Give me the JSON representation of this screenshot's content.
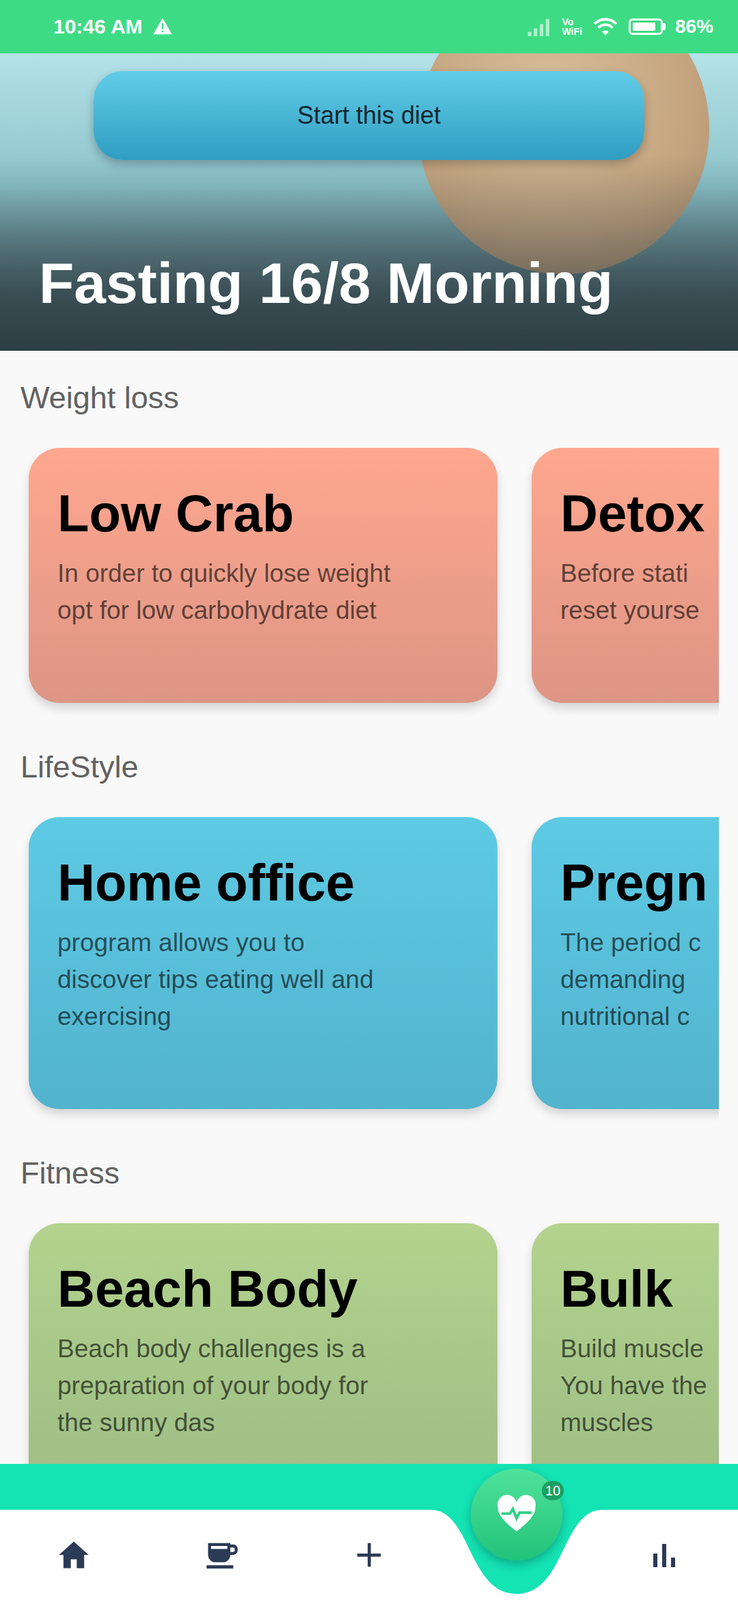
{
  "status_bar": {
    "time": "10:46 AM",
    "network_label_top": "Vo",
    "network_label_bottom": "WiFi",
    "battery": {
      "level": 0.86,
      "reading": "86%"
    }
  },
  "hero": {
    "title": "Fasting 16/8 Morning",
    "button": "Start this diet"
  },
  "sections": [
    {
      "title": "Weight loss",
      "color": "#ffa78f",
      "cards": [
        {
          "title": "Low Crab",
          "lines": [
            "In order to quickly lose weight",
            "opt for low carbohydrate diet"
          ]
        },
        {
          "title": "Detox",
          "lines": [
            "Before stati",
            "reset yourse"
          ]
        }
      ]
    },
    {
      "title": "LifeStyle",
      "color": "#5ecae4",
      "cards": [
        {
          "title": "Home office",
          "lines": [
            "program allows you to",
            "discover tips eating well and",
            "exercising"
          ]
        },
        {
          "title": "Pregn",
          "lines": [
            "The period c",
            "demanding",
            "nutritional c"
          ]
        }
      ]
    },
    {
      "title": "Fitness",
      "color": "#b3d38e",
      "cards": [
        {
          "title": "Beach Body",
          "lines": [
            "Beach body challenges is a",
            "preparation of your body for",
            "the sunny das"
          ]
        },
        {
          "title": "Bulk",
          "lines": [
            "Build muscle",
            "You have the",
            "muscles"
          ]
        }
      ]
    }
  ],
  "nav": {
    "badge": "10"
  }
}
